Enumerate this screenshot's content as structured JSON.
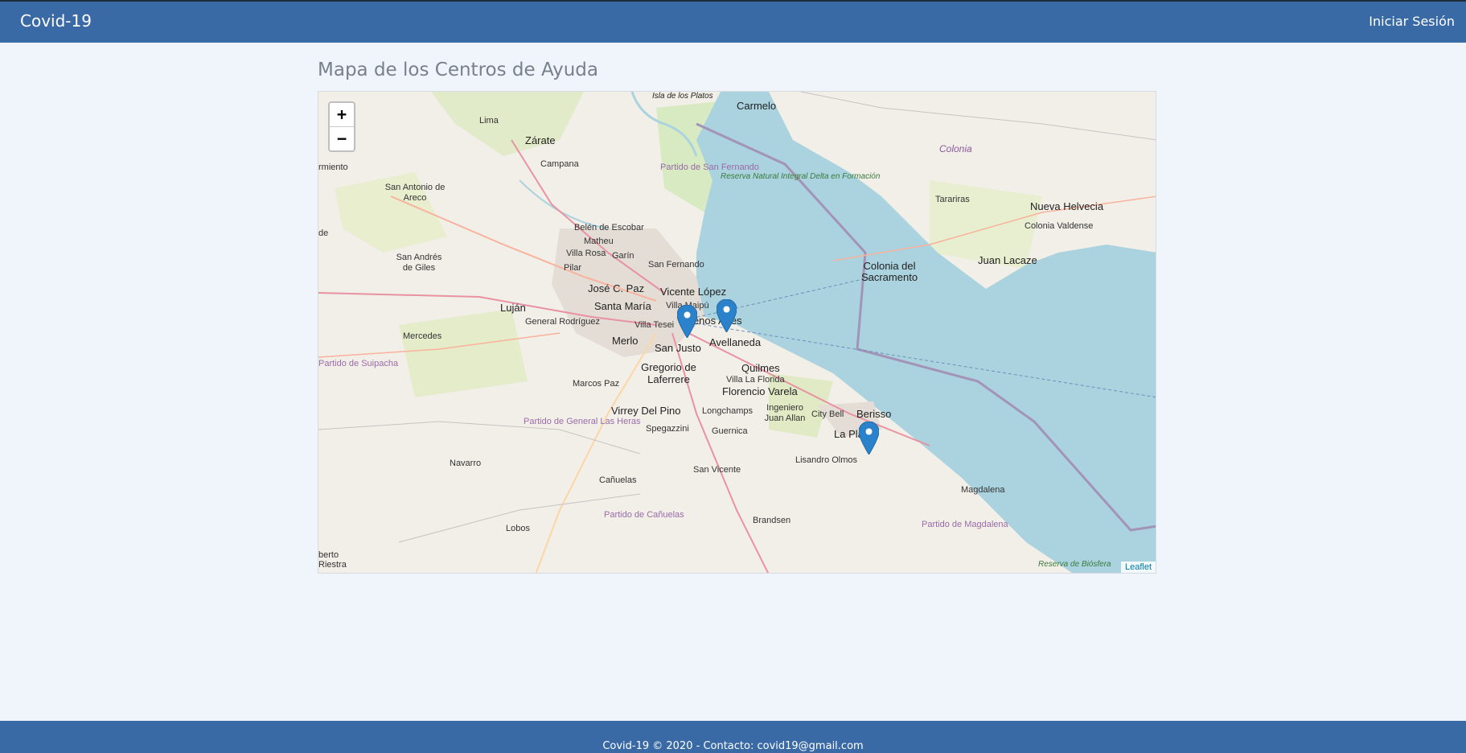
{
  "navbar": {
    "brand": "Covid-19",
    "login_label": "Iniciar Sesión"
  },
  "main": {
    "title": "Mapa de los Centros de Ayuda"
  },
  "map": {
    "zoom_in": "+",
    "zoom_out": "−",
    "attribution": "Leaflet",
    "water_color": "#aad3df",
    "land_color": "#f2efe9",
    "marker_color": "#2b82cb",
    "marker_count": 3,
    "place_labels": {
      "isla_platos": "Isla de los Platos",
      "carmelo": "Carmelo",
      "lima": "Lima",
      "zarate": "Zárate",
      "campana": "Campana",
      "colonia": "Colonia",
      "partido_san_fernando": "Partido de San Fernando",
      "reserva_delta": "Reserva Natural Integral Delta en Formación",
      "tarariras": "Tarariras",
      "nueva_helvecia": "Nueva Helvecia",
      "colonia_valdense": "Colonia Valdense",
      "armiento": "rmiento",
      "san_antonio_areco": "San Antonio de Areco",
      "belen_escobar": "Belén de Escobar",
      "matheu": "Matheu",
      "villa_rosa": "Villa Rosa",
      "garin": "Garín",
      "de": "de",
      "san_andres_giles": "San Andrés de Giles",
      "pilar": "Pilar",
      "san_fernando": "San Fernando",
      "colonia_sacramento": "Colonia del Sacramento",
      "juan_lacaze": "Juan Lacaze",
      "jose_c_paz": "José C. Paz",
      "vicente_lopez": "Vicente López",
      "lujan": "Luján",
      "santa_maria": "Santa María",
      "villa_maipu": "Villa Maipú",
      "general_rodriguez": "General Rodríguez",
      "buenos_aires": "Buenos Aires",
      "villa_tesei": "Villa Tesei",
      "mercedes": "Mercedes",
      "merlo": "Merlo",
      "san_justo": "San Justo",
      "avellaneda": "Avellaneda",
      "partido_suipacha": "Partido de Suipacha",
      "quilmes": "Quilmes",
      "gregorio_laferrere": "Gregorio de Laferrere",
      "marcos_paz": "Marcos Paz",
      "villa_la_florida": "Villa La Florida",
      "florencio_varela": "Florencio Varela",
      "virrey_del_pino": "Virrey Del Pino",
      "longchamps": "Longchamps",
      "ingeniero_juan_allan": "Ingeniero Juan Allan",
      "city_bell": "City Bell",
      "berisso": "Berisso",
      "partido_general_las_heras": "Partido de General Las Heras",
      "spegazzini": "Spegazzini",
      "guernica": "Guernica",
      "la_plata": "La Plata",
      "navarro": "Navarro",
      "lisandro_olmos": "Lisandro Olmos",
      "san_vicente": "San Vicente",
      "magdalena": "Magdalena",
      "canuelas": "Cañuelas",
      "partido_canuelas": "Partido de Cañuelas",
      "brandsen": "Brandsen",
      "partido_magdalena": "Partido de Magdalena",
      "lobos": "Lobos",
      "roberto_riestra": "berto Riestra",
      "reserva_bs": "Reserva de Biósfera"
    }
  },
  "footer": {
    "text": "Covid-19 © 2020 - Contacto: covid19@gmail.com"
  }
}
